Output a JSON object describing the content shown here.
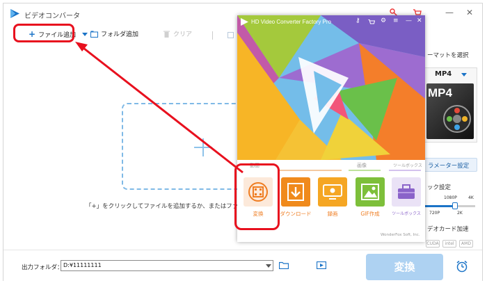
{
  "window": {
    "title": "ビデオコンバータ",
    "minimize_glyph": "—",
    "close_glyph": "✕"
  },
  "toolbar": {
    "add_file_label": "ファイル追加",
    "add_folder_label": "フォルダ追加",
    "clear_label": "クリア",
    "add_file_icon": "plus-icon",
    "add_folder_icon": "folder-add-icon",
    "clear_icon": "trash-icon"
  },
  "drop_zone": {
    "hint": "「+」をクリックしてファイルを追加するか、またはファイ"
  },
  "right_panel": {
    "format_heading": "ーマットを選択",
    "format_value": "MP4",
    "format_thumb_text": "MP4",
    "param_button_label": "ラメーター設定",
    "quality_heading": "ック設定",
    "quality_ticks_top": [
      "1080P",
      "4K"
    ],
    "quality_ticks_bottom": [
      "720P",
      "2K"
    ],
    "gpu_heading": "デオカード加速",
    "gpu_chips": [
      "CUDA",
      "intel",
      "AMD"
    ]
  },
  "bottom_bar": {
    "output_label": "出力フォルダ：",
    "output_value": "D:¥11111111",
    "convert_label": "変換"
  },
  "popup": {
    "title": "HD Video Converter Factory Pro",
    "sections": {
      "video": "動画",
      "image": "画像",
      "toolbox": "ツールボックス"
    },
    "functions": [
      {
        "label": "変換",
        "icon": "film-reel-icon",
        "color": "#ef7d22"
      },
      {
        "label": "ダウンロード",
        "icon": "download-icon",
        "color": "#f08a1c"
      },
      {
        "label": "録画",
        "icon": "screen-record-icon",
        "color": "#f5a623"
      },
      {
        "label": "GIF作成",
        "icon": "image-icon",
        "color": "#7dbf3a"
      },
      {
        "label": "ツールボックス",
        "icon": "toolbox-icon",
        "color": "#8a63c9"
      }
    ],
    "footer": "WonderFox Soft, Inc.",
    "ctrl_icons": [
      "key-icon",
      "cart-icon",
      "gear-icon",
      "menu-icon",
      "minimize-icon",
      "close-icon"
    ]
  },
  "colors": {
    "accent_blue": "#1a73c7",
    "callout_red": "#e8101e",
    "convert_disabled": "#aed2f2"
  }
}
